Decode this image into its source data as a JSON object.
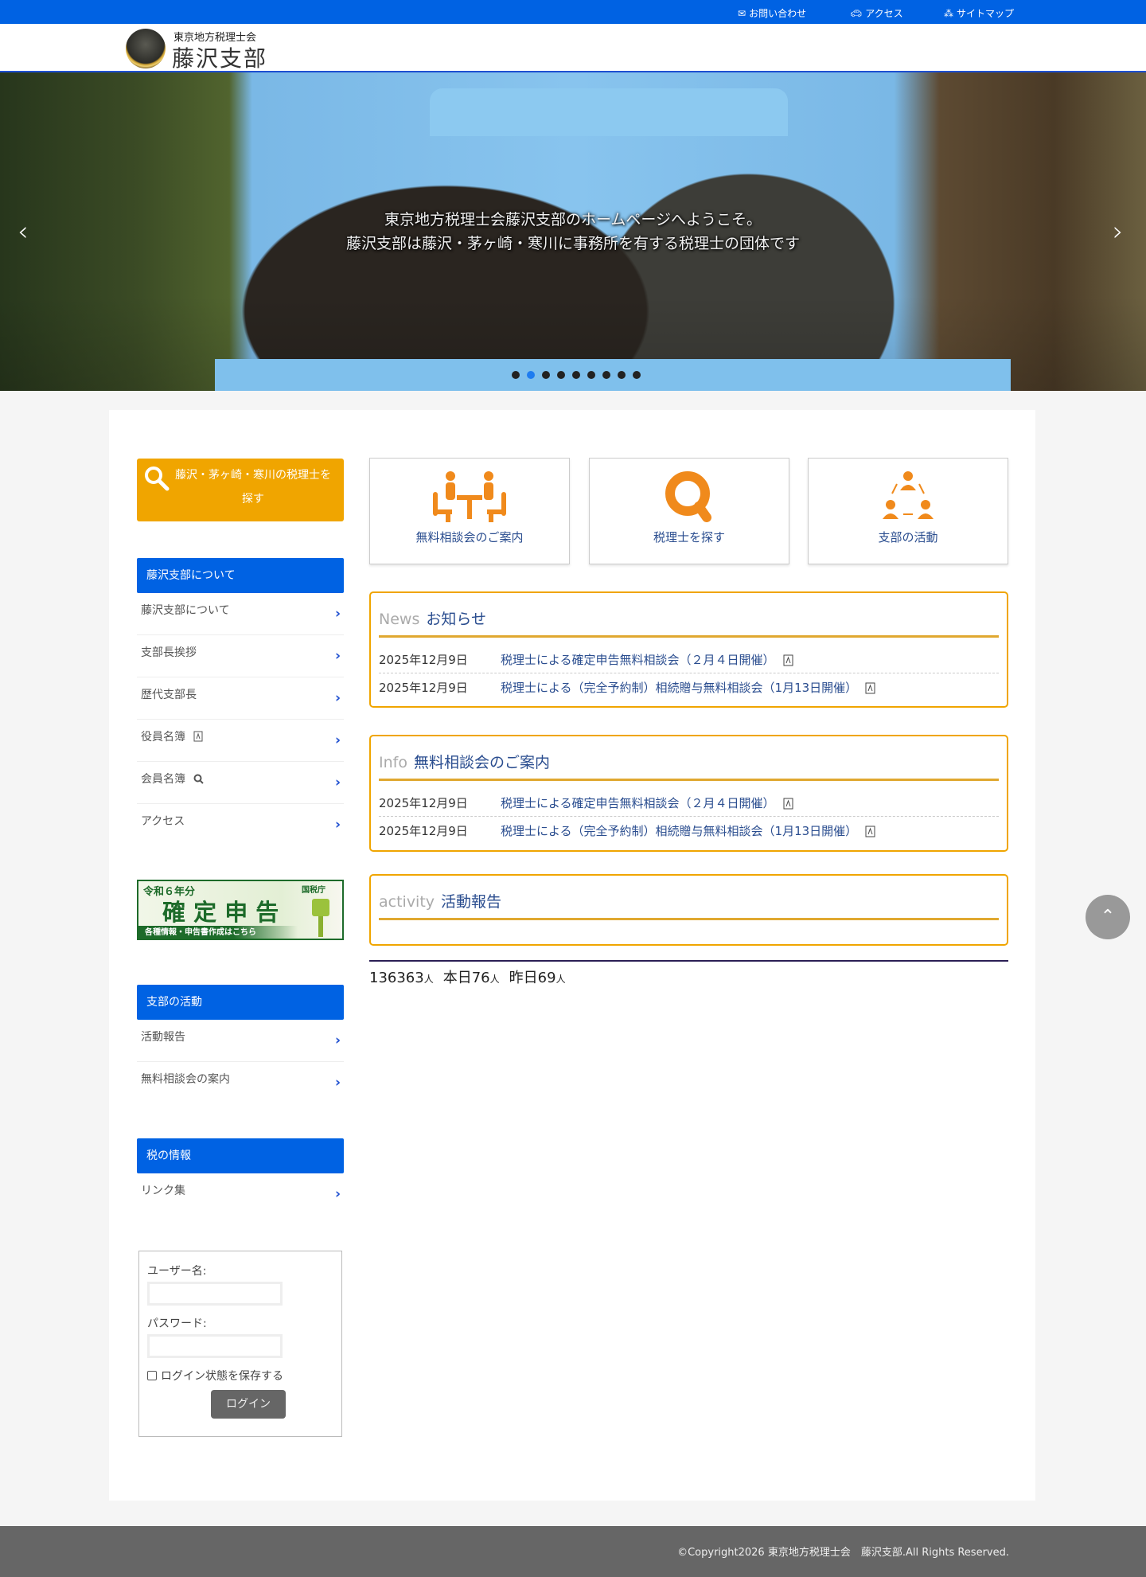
{
  "topbar": {
    "contact": "お問い合わせ",
    "access": "アクセス",
    "sitemap": "サイトマップ"
  },
  "header": {
    "org": "東京地方税理士会",
    "branch": "藤沢支部"
  },
  "hero": {
    "line1": "東京地方税理士会藤沢支部のホームページへようこそ。",
    "line2": "藤沢支部は藤沢・茅ヶ崎・寒川に事務所を有する税理士の団体です",
    "slide_count": 9,
    "active_slide": 2,
    "prev": "‹",
    "next": "›"
  },
  "sidebar": {
    "find_button": "藤沢・茅ヶ崎・寒川の税理士を探す",
    "about": {
      "heading": "藤沢支部について",
      "items": [
        "藤沢支部について",
        "支部長挨拶",
        "歴代支部長",
        "役員名簿",
        "会員名簿",
        "アクセス"
      ]
    },
    "banner": {
      "year": "令和６年分",
      "title": "確 定 申 告",
      "sub": "各種情報・申告書作成はこちら",
      "agency": "国税庁"
    },
    "activity": {
      "heading": "支部の活動",
      "items": [
        "活動報告",
        "無料相談会の案内"
      ]
    },
    "tax": {
      "heading": "税の情報",
      "items": [
        "リンク集"
      ]
    },
    "login": {
      "username_label": "ユーザー名:",
      "password_label": "パスワード:",
      "remember": "ログイン状態を保存する",
      "button": "ログイン"
    }
  },
  "cards": [
    {
      "label": "無料相談会のご案内"
    },
    {
      "label": "税理士を探す"
    },
    {
      "label": "支部の活動"
    }
  ],
  "news": {
    "en": "News",
    "jp": "お知らせ",
    "items": [
      {
        "date": "2025年12月9日",
        "title": "税理士による確定申告無料相談会（２月４日開催）"
      },
      {
        "date": "2025年12月9日",
        "title": "税理士による（完全予約制）相続贈与無料相談会（1月13日開催）"
      }
    ]
  },
  "info": {
    "en": "Info",
    "jp": "無料相談会のご案内",
    "items": [
      {
        "date": "2025年12月9日",
        "title": "税理士による確定申告無料相談会（２月４日開催）"
      },
      {
        "date": "2025年12月9日",
        "title": "税理士による（完全予約制）相続贈与無料相談会（1月13日開催）"
      }
    ]
  },
  "activity": {
    "en": "activity",
    "jp": "活動報告"
  },
  "counter": {
    "total": "136363",
    "unit": "人",
    "today_label": "本日76",
    "yesterday_label": "昨日69"
  },
  "footer": {
    "copyright": "©Copyright2026 東京地方税理士会　藤沢支部.All Rights Reserved."
  },
  "colors": {
    "blue": "#0062e3",
    "orange": "#f0a500",
    "navy": "#2a4d8f"
  }
}
